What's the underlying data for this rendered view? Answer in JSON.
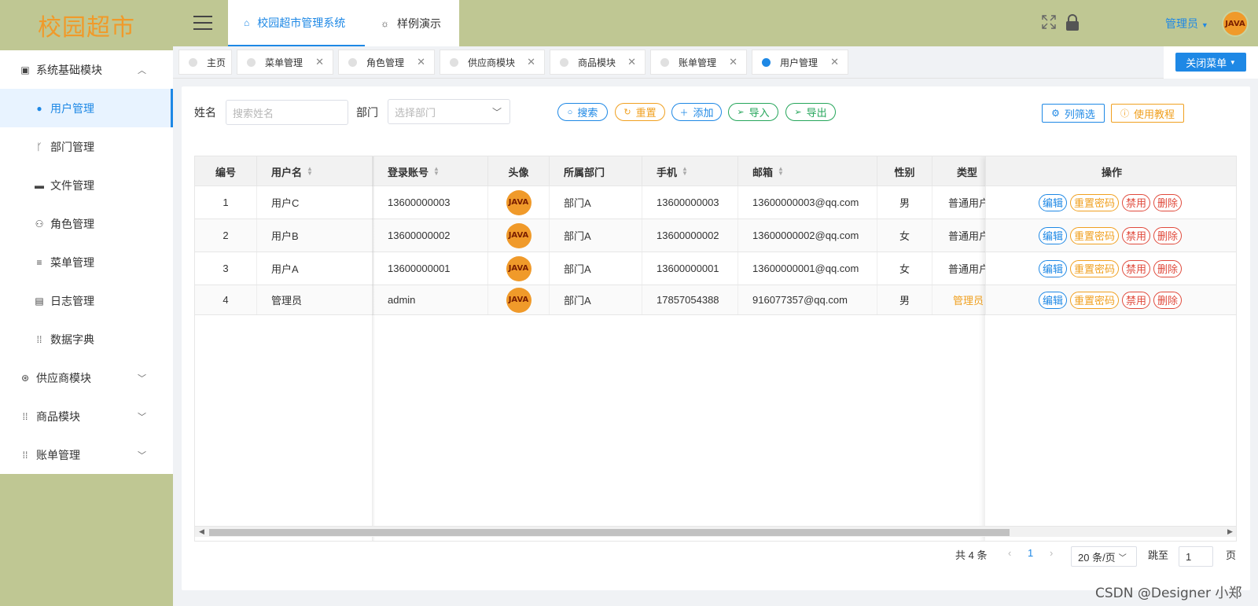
{
  "app": {
    "logo_text": "校园超市"
  },
  "sidebar": {
    "items": [
      {
        "label": "系统基础模块",
        "icon": "chart-icon",
        "expanded": true
      },
      {
        "label": "用户管理",
        "icon": "user-icon",
        "active": true
      },
      {
        "label": "部门管理",
        "icon": "branch-icon"
      },
      {
        "label": "文件管理",
        "icon": "folder-icon"
      },
      {
        "label": "角色管理",
        "icon": "users-icon"
      },
      {
        "label": "菜单管理",
        "icon": "list-icon"
      },
      {
        "label": "日志管理",
        "icon": "log-icon"
      },
      {
        "label": "数据字典",
        "icon": "grid-icon"
      },
      {
        "label": "供应商模块",
        "icon": "supplier-icon"
      },
      {
        "label": "商品模块",
        "icon": "grid-icon"
      },
      {
        "label": "账单管理",
        "icon": "grid-icon"
      }
    ]
  },
  "header": {
    "tabs": [
      {
        "label": "校园超市管理系统",
        "icon": "home-icon",
        "active": true
      },
      {
        "label": "样例演示",
        "icon": "bulb-icon"
      }
    ],
    "user_label": "管理员",
    "avatar_text": "JAVA"
  },
  "tagbar": {
    "tags": [
      {
        "label": "主页",
        "closable": false
      },
      {
        "label": "菜单管理",
        "closable": true
      },
      {
        "label": "角色管理",
        "closable": true
      },
      {
        "label": "供应商模块",
        "closable": true
      },
      {
        "label": "商品模块",
        "closable": true
      },
      {
        "label": "账单管理",
        "closable": true
      },
      {
        "label": "用户管理",
        "closable": true,
        "active": true
      }
    ],
    "close_menu_label": "关闭菜单"
  },
  "search": {
    "name_label": "姓名",
    "name_placeholder": "搜索姓名",
    "dept_label": "部门",
    "dept_placeholder": "选择部门",
    "buttons": {
      "search": "搜索",
      "reset": "重置",
      "add": "添加",
      "import": "导入",
      "export": "导出",
      "column_filter": "列筛选",
      "tutorial": "使用教程"
    }
  },
  "table": {
    "headers": {
      "id": "编号",
      "username": "用户名",
      "account": "登录账号",
      "avatar": "头像",
      "dept": "所属部门",
      "phone": "手机",
      "email": "邮箱",
      "gender": "性别",
      "type": "类型",
      "ops": "操作"
    },
    "rows": [
      {
        "id": "1",
        "username": "用户C",
        "account": "13600000003",
        "avatar": "JAVA",
        "dept": "部门A",
        "phone": "13600000003",
        "email": "13600000003@qq.com",
        "gender": "男",
        "type": "普通用户"
      },
      {
        "id": "2",
        "username": "用户B",
        "account": "13600000002",
        "avatar": "JAVA",
        "dept": "部门A",
        "phone": "13600000002",
        "email": "13600000002@qq.com",
        "gender": "女",
        "type": "普通用户"
      },
      {
        "id": "3",
        "username": "用户A",
        "account": "13600000001",
        "avatar": "JAVA",
        "dept": "部门A",
        "phone": "13600000001",
        "email": "13600000001@qq.com",
        "gender": "女",
        "type": "普通用户"
      },
      {
        "id": "4",
        "username": "管理员",
        "account": "admin",
        "avatar": "JAVA",
        "dept": "部门A",
        "phone": "17857054388",
        "email": "916077357@qq.com",
        "gender": "男",
        "type": "管理员"
      }
    ],
    "ops": {
      "edit": "编辑",
      "reset_pwd": "重置密码",
      "disable": "禁用",
      "delete": "删除"
    }
  },
  "pagination": {
    "total_text": "共 4 条",
    "current_page": "1",
    "page_size": "20 条/页",
    "jump_label": "跳至",
    "jump_value": "1",
    "page_suffix": "页"
  },
  "watermark": "CSDN @Designer 小郑",
  "colors": {
    "primary": "#1e88e5",
    "warning": "#f0a020",
    "danger": "#e04a3c",
    "success": "#26a65b",
    "brand_bg": "#bfc793"
  }
}
